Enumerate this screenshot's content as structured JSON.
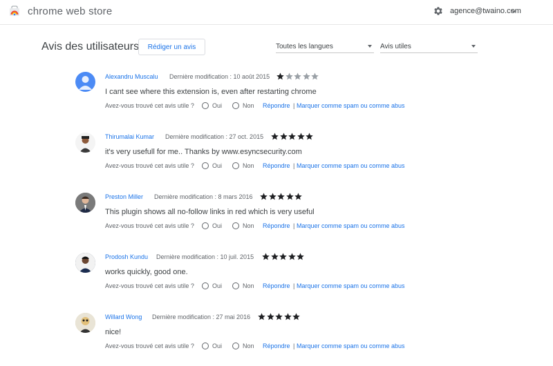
{
  "header": {
    "app_title": "chrome web store",
    "account_email": "agence@twaino.com",
    "icons": {
      "logo": "chrome-web-store-logo",
      "settings": "gear-icon",
      "account_menu": "chevron-down-icon"
    }
  },
  "reviews_section": {
    "title": "Avis des utilisateurs",
    "write_review_label": "Rédiger un avis",
    "language_filter": {
      "selected": "Toutes les langues"
    },
    "sort_filter": {
      "selected": "Avis utiles"
    }
  },
  "labels": {
    "helpful_question": "Avez-vous trouvé cet avis utile ?",
    "yes": "Oui",
    "no": "Non",
    "reply": "Répondre",
    "separator": "|",
    "report": "Marquer comme spam ou comme abus"
  },
  "colors": {
    "link": "#1a73e8",
    "star_filled": "#202124",
    "star_empty": "#9aa0a6",
    "default_avatar": "#4c8bf5"
  },
  "reviews": [
    {
      "author": "Alexandru Muscalu",
      "modified": "Dernière modification : 10 août 2015",
      "rating": 1,
      "text": "I cant see where this extension is, even after restarting chrome",
      "avatar": "default-person-avatar"
    },
    {
      "author": "Thirumalai Kumar",
      "modified": "Dernière modification : 27 oct. 2015",
      "rating": 5,
      "text": "it's very usefull for me.. Thanks by www.esyncsecurity.com",
      "avatar": "user-photo"
    },
    {
      "author": "Preston Miller",
      "modified": "Dernière modification : 8 mars 2016",
      "rating": 5,
      "text": "This plugin shows all no-follow links in red which is very useful",
      "avatar": "user-photo"
    },
    {
      "author": "Prodosh Kundu",
      "modified": "Dernière modification : 10 juil. 2015",
      "rating": 5,
      "text": "works quickly, good one.",
      "avatar": "user-photo"
    },
    {
      "author": "Willard Wong",
      "modified": "Dernière modification : 27 mai 2016",
      "rating": 5,
      "text": "nice!",
      "avatar": "user-photo"
    }
  ]
}
